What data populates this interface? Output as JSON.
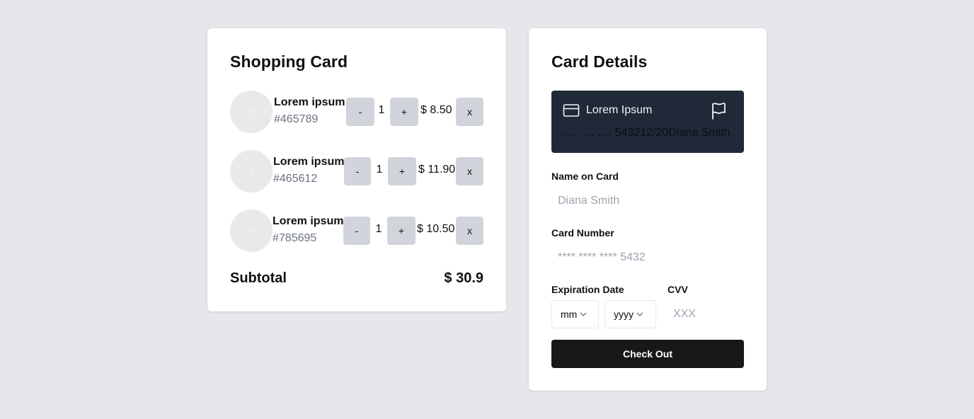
{
  "cart": {
    "title": "Shopping Card",
    "items": [
      {
        "name": "Lorem ipsum",
        "sku": "#465789",
        "qty": "1",
        "price": "$ 8.50",
        "minus": "-",
        "plus": "+",
        "remove": "x"
      },
      {
        "name": "Lorem ipsum",
        "sku": "#465612",
        "qty": "1",
        "price": "$ 11.90",
        "minus": "-",
        "plus": "+",
        "remove": "x"
      },
      {
        "name": "Lorem ipsum",
        "sku": "#785695",
        "qty": "1",
        "price": "$ 10.50",
        "minus": "-",
        "plus": "+",
        "remove": "x"
      }
    ],
    "subtotal_label": "Subtotal",
    "subtotal_value": "$ 30.9"
  },
  "card": {
    "title": "Card Details",
    "preview": {
      "holder": "Lorem Ipsum",
      "masked": ".... .... ....",
      "number_tail": "5432",
      "expiry": "12/20",
      "name": "Diana Smith"
    },
    "name_label": "Name on Card",
    "name_placeholder": "Diana Smith",
    "number_label": "Card Number",
    "number_placeholder": "**** **** **** 5432",
    "expiry_label": "Expiration Date",
    "month_value": "mm",
    "year_value": "yyyy",
    "cvv_label": "CVV",
    "cvv_placeholder": "XXX",
    "checkout_label": "Check Out"
  },
  "colors": {
    "background": "#e5e7eb",
    "card_preview": "#1f2937",
    "checkout": "#18181b",
    "qty_button": "#d1d5db"
  },
  "icons": [
    "credit-card-icon",
    "flag-icon",
    "chevron-down-icon"
  ]
}
